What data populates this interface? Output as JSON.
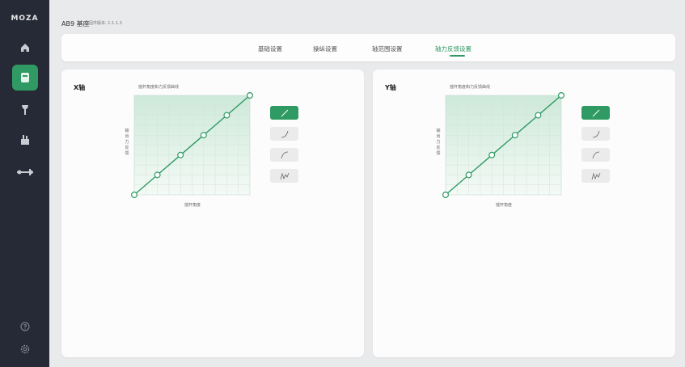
{
  "sidebar": {
    "logo": "MOZA",
    "items": [
      {
        "icon": "home-icon"
      },
      {
        "icon": "joystick-base-icon",
        "active": true
      },
      {
        "icon": "joystick-grip-icon"
      },
      {
        "icon": "throttle-icon"
      },
      {
        "icon": "pedals-icon"
      }
    ],
    "bottom": [
      {
        "icon": "help-icon"
      },
      {
        "icon": "settings-icon"
      }
    ]
  },
  "header": {
    "title": "AB9 基座",
    "firmware_label": "固件版本: 1.1.1.3"
  },
  "tabs": [
    {
      "label": "基础设置"
    },
    {
      "label": "操纵设置"
    },
    {
      "label": "轴范围设置"
    },
    {
      "label": "轴力反馈设置",
      "active": true
    }
  ],
  "accent_color": "#2f9a63",
  "panels": [
    {
      "title": "X轴",
      "chart_title": "摇杆角度和力反馈曲线",
      "ylabel": "输出力反馈",
      "xlabel": "摇杆角度",
      "selected_curve": "linear"
    },
    {
      "title": "Y轴",
      "chart_title": "摇杆角度和力反馈曲线",
      "ylabel": "输出力反馈",
      "xlabel": "摇杆角度",
      "selected_curve": "linear"
    }
  ],
  "curve_presets": [
    {
      "icon": "linear-curve-icon"
    },
    {
      "icon": "exponential-curve-icon"
    },
    {
      "icon": "logarithmic-curve-icon"
    },
    {
      "icon": "custom-curve-icon"
    }
  ],
  "chart_data": [
    {
      "type": "line",
      "title": "摇杆角度和力反馈曲线",
      "xlabel": "摇杆角度",
      "ylabel": "输出力反馈",
      "x": [
        0,
        20,
        40,
        60,
        80,
        100
      ],
      "series": [
        {
          "values": [
            0,
            20,
            40,
            60,
            80,
            100
          ]
        }
      ],
      "xlim": [
        0,
        100
      ],
      "ylim": [
        0,
        100
      ],
      "grid": true
    },
    {
      "type": "line",
      "title": "摇杆角度和力反馈曲线",
      "xlabel": "摇杆角度",
      "ylabel": "输出力反馈",
      "x": [
        0,
        20,
        40,
        60,
        80,
        100
      ],
      "series": [
        {
          "values": [
            0,
            20,
            40,
            60,
            80,
            100
          ]
        }
      ],
      "xlim": [
        0,
        100
      ],
      "ylim": [
        0,
        100
      ],
      "grid": true
    }
  ]
}
